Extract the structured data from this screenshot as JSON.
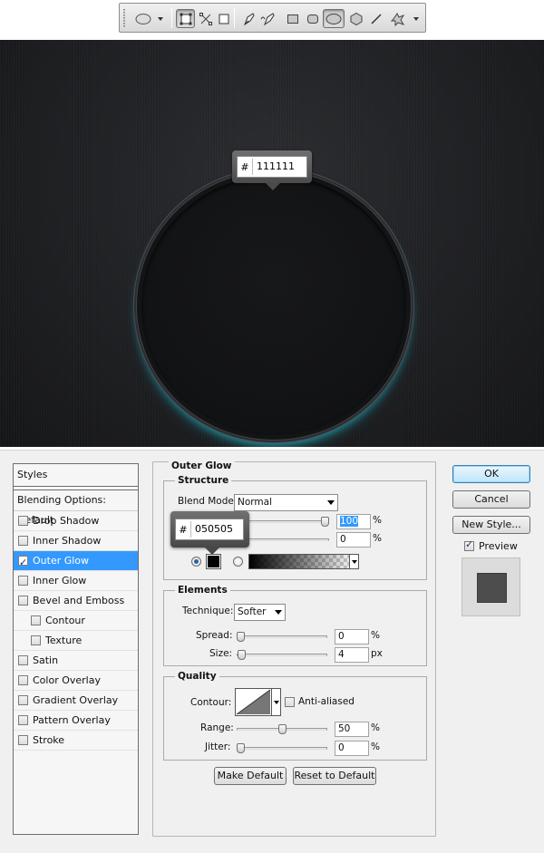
{
  "toolbar": {
    "tools": [
      "ellipse-tool-preset",
      "shape-layers-mode",
      "paths-mode",
      "fill-pixels-mode",
      "pen-tool",
      "freeform-pen-tool",
      "rectangle-tool",
      "rounded-rectangle-tool",
      "ellipse-tool",
      "polygon-tool",
      "line-tool",
      "custom-shape-tool"
    ]
  },
  "canvas": {
    "hex_tooltip": {
      "hash": "#",
      "value": "111111"
    },
    "colors": {
      "ring_glow": "#1aa3b5",
      "background": "#222326",
      "circle_fill": "#131416"
    }
  },
  "color_tooltip": {
    "hash": "#",
    "value": "050505"
  },
  "styles_panel": {
    "header": "Styles",
    "blending_options": "Blending Options: Default",
    "items": [
      {
        "label": "Drop Shadow",
        "checked": false,
        "sub": false
      },
      {
        "label": "Inner Shadow",
        "checked": false,
        "sub": false
      },
      {
        "label": "Outer Glow",
        "checked": true,
        "sub": false,
        "selected": true
      },
      {
        "label": "Inner Glow",
        "checked": false,
        "sub": false
      },
      {
        "label": "Bevel and Emboss",
        "checked": false,
        "sub": false
      },
      {
        "label": "Contour",
        "checked": false,
        "sub": true
      },
      {
        "label": "Texture",
        "checked": false,
        "sub": true
      },
      {
        "label": "Satin",
        "checked": false,
        "sub": false
      },
      {
        "label": "Color Overlay",
        "checked": false,
        "sub": false
      },
      {
        "label": "Gradient Overlay",
        "checked": false,
        "sub": false
      },
      {
        "label": "Pattern Overlay",
        "checked": false,
        "sub": false
      },
      {
        "label": "Stroke",
        "checked": false,
        "sub": false
      }
    ]
  },
  "outer_glow": {
    "title": "Outer Glow",
    "structure": {
      "title": "Structure",
      "blend_mode_label": "Blend Mode:",
      "blend_mode_value": "Normal",
      "opacity_value": "100",
      "opacity_level": 1.0,
      "noise_value": "0",
      "noise_level": 0.0,
      "percent": "%",
      "glow_color": "#050505"
    },
    "elements": {
      "title": "Elements",
      "technique_label": "Technique:",
      "technique_value": "Softer",
      "spread_label": "Spread:",
      "spread_value": "0",
      "spread_unit": "%",
      "size_label": "Size:",
      "size_value": "4",
      "size_unit": "px"
    },
    "quality": {
      "title": "Quality",
      "contour_label": "Contour:",
      "anti_aliased_label": "Anti-aliased",
      "range_label": "Range:",
      "range_value": "50",
      "range_unit": "%",
      "jitter_label": "Jitter:",
      "jitter_value": "0",
      "jitter_unit": "%"
    },
    "make_default": "Make Default",
    "reset_to_default": "Reset to Default"
  },
  "buttons": {
    "ok": "OK",
    "cancel": "Cancel",
    "new_style": "New Style...",
    "preview_label": "Preview"
  }
}
